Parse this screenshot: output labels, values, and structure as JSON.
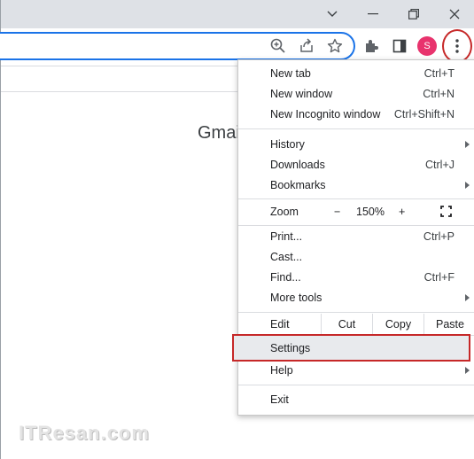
{
  "browser": {
    "profile_initial": "S",
    "page_heading": "Gmai"
  },
  "menu": {
    "new_tab": {
      "label": "New tab",
      "shortcut": "Ctrl+T"
    },
    "new_window": {
      "label": "New window",
      "shortcut": "Ctrl+N"
    },
    "new_incognito": {
      "label": "New Incognito window",
      "shortcut": "Ctrl+Shift+N"
    },
    "history": {
      "label": "History"
    },
    "downloads": {
      "label": "Downloads",
      "shortcut": "Ctrl+J"
    },
    "bookmarks": {
      "label": "Bookmarks"
    },
    "zoom": {
      "label": "Zoom",
      "minus": "−",
      "value": "150%",
      "plus": "+"
    },
    "print": {
      "label": "Print...",
      "shortcut": "Ctrl+P"
    },
    "cast": {
      "label": "Cast..."
    },
    "find": {
      "label": "Find...",
      "shortcut": "Ctrl+F"
    },
    "more_tools": {
      "label": "More tools"
    },
    "edit": {
      "label": "Edit",
      "cut": "Cut",
      "copy": "Copy",
      "paste": "Paste"
    },
    "settings": {
      "label": "Settings"
    },
    "help": {
      "label": "Help"
    },
    "exit": {
      "label": "Exit"
    }
  },
  "watermark": "ITResan.com",
  "colors": {
    "highlight_red": "#c62828",
    "avatar_pink": "#e8336d",
    "omnibox_blue": "#1a73e8"
  }
}
